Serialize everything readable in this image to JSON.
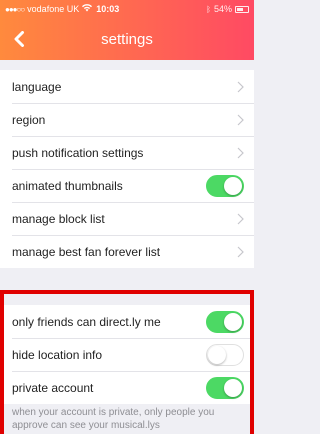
{
  "status_bar": {
    "signal": "●●●○○",
    "carrier": "vodafone UK",
    "time": "10:03",
    "battery": "54%"
  },
  "nav": {
    "title": "settings",
    "back_icon": "chevron-left-icon"
  },
  "group1": {
    "items": [
      {
        "label": "language",
        "type": "link"
      },
      {
        "label": "region",
        "type": "link"
      },
      {
        "label": "push notification settings",
        "type": "link"
      },
      {
        "label": "animated thumbnails",
        "type": "toggle",
        "on": true
      },
      {
        "label": "manage block list",
        "type": "link"
      },
      {
        "label": "manage best fan forever list",
        "type": "link"
      }
    ]
  },
  "group2": {
    "items": [
      {
        "label": "only friends can direct.ly me",
        "type": "toggle",
        "on": true
      },
      {
        "label": "hide location info",
        "type": "toggle",
        "on": false
      },
      {
        "label": "private account",
        "type": "toggle",
        "on": true
      }
    ],
    "footer": "when your account is private, only people you approve can see your musical.lys"
  },
  "colors": {
    "header_start": "#ff8a3d",
    "header_end": "#ff4a63",
    "toggle_on": "#4cd964",
    "highlight": "#e00000"
  }
}
